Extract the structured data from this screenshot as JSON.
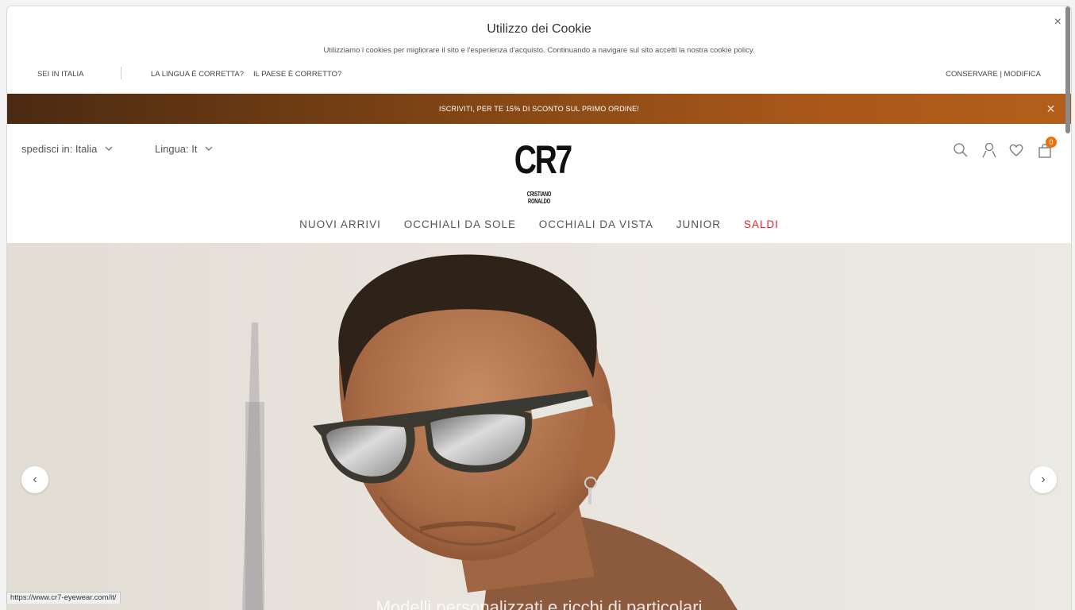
{
  "cookie": {
    "title": "Utilizzo dei Cookie",
    "text": "Utilizziamo i cookies per migliorare il sito e l'esperienza d'acquisto. Continuando a navigare sul sito accetti la nostra cookie policy.",
    "close": "×",
    "sei_in": "SEI IN ITALIA",
    "lingua_question": "LA LINGUA È CORRETTA?",
    "paese_question": "IL PAESE È CORRETTO?",
    "conserva": "CONSERVARE | MODIFICA"
  },
  "promo": {
    "text": "ISCRIVITI, PER TE 15% DI SCONTO SUL PRIMO ORDINE!",
    "close": "×"
  },
  "header": {
    "ship_to": "spedisci in: Italia",
    "language": "Lingua: It",
    "logo_main": "CR7",
    "logo_sub": "CRISTIANO RONALDO",
    "cart_count": "0",
    "icons": [
      "search-icon",
      "user-icon",
      "heart-icon",
      "bag-icon"
    ]
  },
  "nav": {
    "items": [
      "NUOVI ARRIVI",
      "OCCHIALI DA SOLE",
      "OCCHIALI DA VISTA",
      "JUNIOR",
      "SALDI"
    ]
  },
  "hero": {
    "caption": "Modelli personalizzati e ricchi di particolari",
    "prev": "‹",
    "next": "›"
  },
  "status_url": "https://www.cr7-eyewear.com/it/",
  "colors": {
    "promo_start": "#4a2a12",
    "promo_end": "#b35f1b",
    "saldi": "#e3242b",
    "badge": "#e8720c"
  }
}
